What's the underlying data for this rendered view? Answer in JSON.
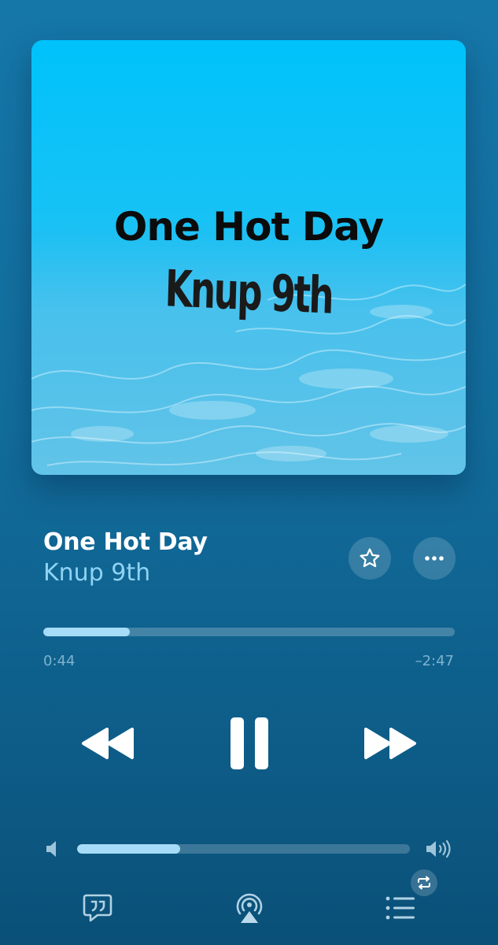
{
  "artwork": {
    "title_text": "One Hot Day",
    "artist_text": "Knup 9th"
  },
  "now_playing": {
    "title": "One Hot Day",
    "artist": "Knup 9th"
  },
  "progress": {
    "elapsed": "0:44",
    "remaining": "–2:47",
    "fraction": 0.21
  },
  "volume": {
    "fraction": 0.31
  },
  "icons": {
    "favorite": "star-icon",
    "more": "ellipsis-icon",
    "rewind": "rewind-icon",
    "pause": "pause-icon",
    "forward": "fast-forward-icon",
    "volume_low": "speaker-low-icon",
    "volume_high": "speaker-high-icon",
    "lyrics": "lyrics-quote-icon",
    "airplay": "airplay-icon",
    "queue": "queue-list-icon",
    "repeat": "repeat-icon"
  },
  "colors": {
    "background": "#126d9c",
    "accent": "#a6dcf7",
    "artist_text": "#8fd3f4"
  }
}
